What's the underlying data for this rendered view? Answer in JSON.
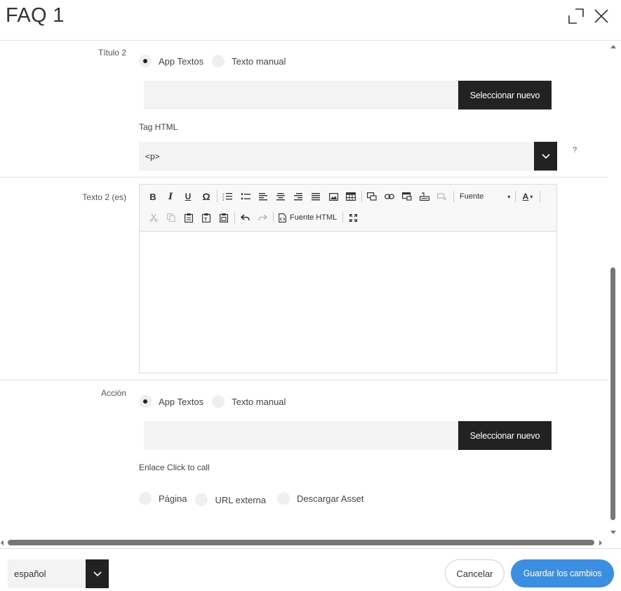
{
  "dialog": {
    "title": "FAQ 1"
  },
  "titulo2": {
    "label": "Título 2",
    "radio_app": "App Textos",
    "radio_manual": "Texto manual",
    "selected": "App Textos",
    "select_button": "Seleccionar nuevo",
    "tag_label": "Tag HTML",
    "tag_value": "<p>",
    "help": "?"
  },
  "texto2": {
    "label": "Texto 2 (es)",
    "toolbar": {
      "font_label": "Fuente",
      "source_label": "Fuente HTML",
      "color_label": "A"
    }
  },
  "accion": {
    "label": "Acción",
    "radio_app": "App Textos",
    "radio_manual": "Texto manual",
    "selected": "App Textos",
    "select_button": "Seleccionar nuevo",
    "link_label": "Enlace Click to call",
    "link_options": [
      "Página",
      "URL externa",
      "Descargar Asset"
    ]
  },
  "footer": {
    "language": "español",
    "cancel": "Cancelar",
    "save": "Guardar los cambios"
  },
  "colors": {
    "accent": "#3b8ee0",
    "dark_button": "#222222",
    "field_bg": "#f3f3f3"
  }
}
